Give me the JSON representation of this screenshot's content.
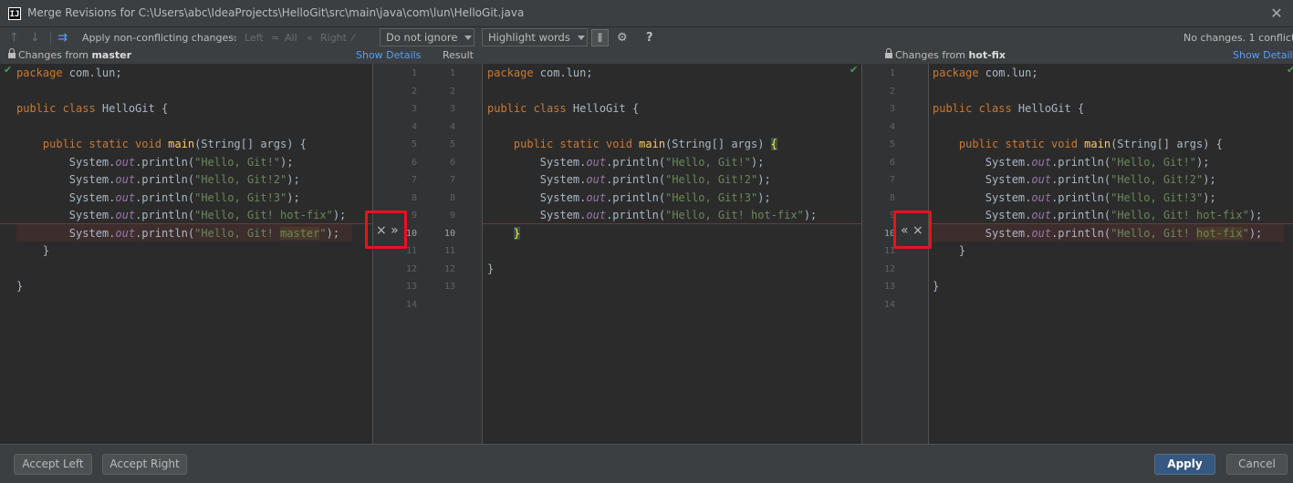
{
  "window": {
    "title": "Merge Revisions for C:\\Users\\abc\\IdeaProjects\\HelloGit\\src\\main\\java\\com\\lun\\HelloGit.java",
    "app_icon": "IJ"
  },
  "toolbar": {
    "apply_nonconflicting_label": "Apply non-conflicting changes:",
    "left_label": "Left",
    "all_label": "All",
    "right_label": "Right",
    "ignore_select": "Do not ignore",
    "highlight_select": "Highlight words",
    "help_label": "?",
    "status": "No changes. 1 conflict"
  },
  "headers": {
    "left_prefix": "Changes from",
    "left_branch": "master",
    "left_show_details": "Show Details",
    "result": "Result",
    "right_prefix": "Changes from",
    "right_branch": "hot-fix",
    "right_show_details": "Show Details"
  },
  "gutters": {
    "left": [
      "1",
      "2",
      "3",
      "4",
      "5",
      "6",
      "7",
      "8",
      "9",
      "10",
      "11",
      "12",
      "13",
      "14"
    ],
    "result": [
      "1",
      "2",
      "3",
      "4",
      "5",
      "6",
      "7",
      "8",
      "9",
      "10",
      "11",
      "12",
      "13"
    ],
    "right": [
      "1",
      "2",
      "3",
      "4",
      "5",
      "6",
      "7",
      "8",
      "9",
      "10",
      "11",
      "12",
      "13",
      "14"
    ]
  },
  "code": {
    "l1": "package com.lun;",
    "l3_a": "public class ",
    "l3_b": "HelloGit {",
    "l5_a": "    public static void ",
    "l5_b": "main",
    "l5_c": "(String[] args) {",
    "p1": "        System.",
    "p2": "out",
    "p3": ".println(",
    "s1": "\"Hello, Git!\"",
    "s2": "\"Hello, Git!2\"",
    "s3": "\"Hello, Git!3\"",
    "s4": "\"Hello, Git! hot-fix\"",
    "s5_a": "\"Hello, Git! ",
    "s5_master": "master",
    "s5_hotfix": "hot-fix",
    "s5_b": "\"",
    "end": ");",
    "close_method": "    }",
    "close_result_method": "    }",
    "close_class": "}"
  },
  "buttons": {
    "accept_left": "Accept Left",
    "accept_right": "Accept Right",
    "apply": "Apply",
    "cancel": "Cancel"
  },
  "markers": {
    "left_conflict": "× »",
    "right_conflict": "« ×",
    "check": "✔"
  },
  "colors": {
    "keyword": "#cc7832",
    "string": "#6a8759",
    "field": "#9876aa",
    "method": "#ffc66d",
    "link": "#589df6",
    "conflict_box": "#e8121c",
    "apply_button": "#365880"
  }
}
